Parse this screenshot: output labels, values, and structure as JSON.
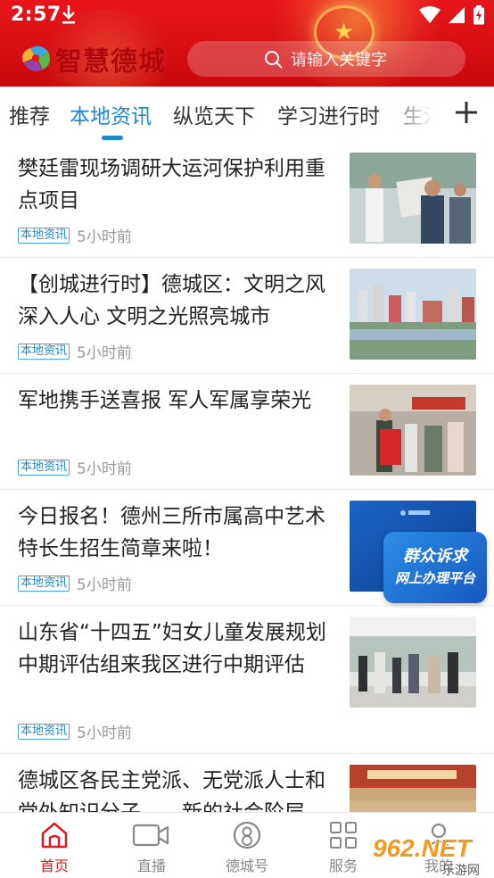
{
  "status_bar": {
    "time": "2:57"
  },
  "header": {
    "app_name": "智慧德城",
    "search_placeholder": "请输入关键字",
    "accent_color": "#e8151b"
  },
  "tabs": [
    {
      "label": "推荐",
      "active": false
    },
    {
      "label": "本地资讯",
      "active": true
    },
    {
      "label": "纵览天下",
      "active": false
    },
    {
      "label": "学习进行时",
      "active": false
    },
    {
      "label": "生活",
      "active": false
    }
  ],
  "news": [
    {
      "title": "樊廷雷现场调研大运河保护利用重点项目",
      "tag": "本地资讯",
      "time": "5小时前",
      "thumb": "officials-inspection-photo"
    },
    {
      "title": "【创城进行时】德城区：文明之风深入人心 文明之光照亮城市",
      "tag": "本地资讯",
      "time": "5小时前",
      "thumb": "city-aerial-photo"
    },
    {
      "title": "军地携手送喜报 军人军属享荣光",
      "tag": "本地资讯",
      "time": "5小时前",
      "thumb": "street-ceremony-photo"
    },
    {
      "title": "今日报名！德州三所市属高中艺术特长生招生简章来啦！",
      "tag": "本地资讯",
      "time": "5小时前",
      "thumb": "blue-banner-image"
    },
    {
      "title": "山东省“十四五”妇女儿童发展规划中期评估组来我区进行中期评估",
      "tag": "本地资讯",
      "time": "5小时前",
      "thumb": "hall-visit-photo"
    },
    {
      "title": "德城区各民主党派、无党派人士和党外知识分子——新的社会阶层",
      "tag": "",
      "time": "",
      "thumb": "meeting-room-photo"
    }
  ],
  "floating_banner": {
    "line1": "群众诉求",
    "line2": "网上办理平台"
  },
  "bottom_nav": [
    {
      "label": "首页",
      "icon": "home-icon",
      "active": true
    },
    {
      "label": "直播",
      "icon": "video-camera-icon",
      "active": false
    },
    {
      "label": "德城号",
      "icon": "profile-circle-icon",
      "active": false
    },
    {
      "label": "服务",
      "icon": "grid-icon",
      "active": false
    },
    {
      "label": "我的",
      "icon": "user-icon",
      "active": false
    }
  ],
  "watermark": {
    "text": "962.NET",
    "subtext": "乐游网"
  }
}
